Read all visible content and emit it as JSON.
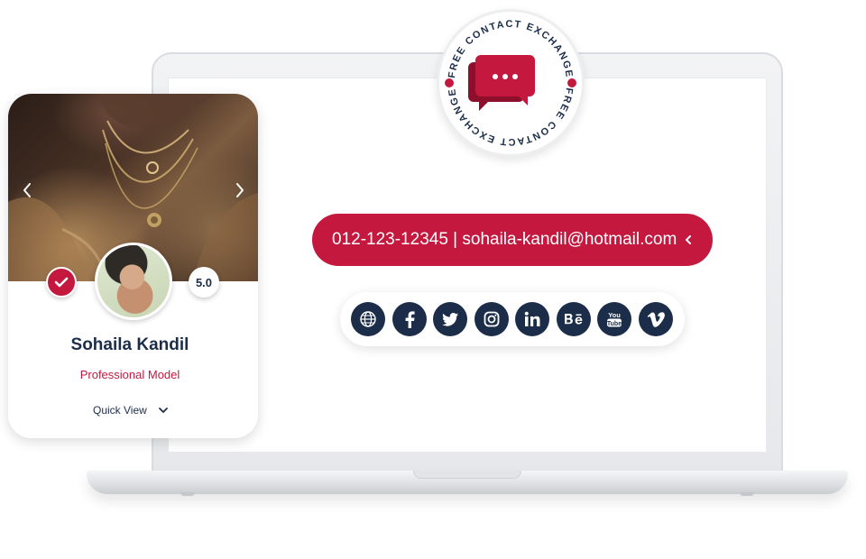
{
  "badge": {
    "ring_text_top": "FREE CONTACT EXCHANGE",
    "ring_text_bottom": "FREE CONTACT EXCHANGE",
    "icon": "chat-bubbles-icon"
  },
  "contact": {
    "text": "012-123-12345 | sohaila-kandil@hotmail.com",
    "toggle_icon": "chevron-left-icon"
  },
  "social": [
    {
      "name": "website",
      "icon": "globe-icon"
    },
    {
      "name": "facebook",
      "icon": "facebook-icon"
    },
    {
      "name": "twitter",
      "icon": "twitter-icon"
    },
    {
      "name": "instagram",
      "icon": "instagram-icon"
    },
    {
      "name": "linkedin",
      "icon": "linkedin-icon"
    },
    {
      "name": "behance",
      "icon": "behance-icon"
    },
    {
      "name": "youtube",
      "icon": "youtube-icon"
    },
    {
      "name": "vimeo",
      "icon": "vimeo-icon"
    }
  ],
  "profile": {
    "name": "Sohaila Kandil",
    "role": "Professional Model",
    "rating": "5.0",
    "quick_view": "Quick View"
  },
  "colors": {
    "accent": "#c4183f",
    "navy": "#1c2d4a"
  }
}
